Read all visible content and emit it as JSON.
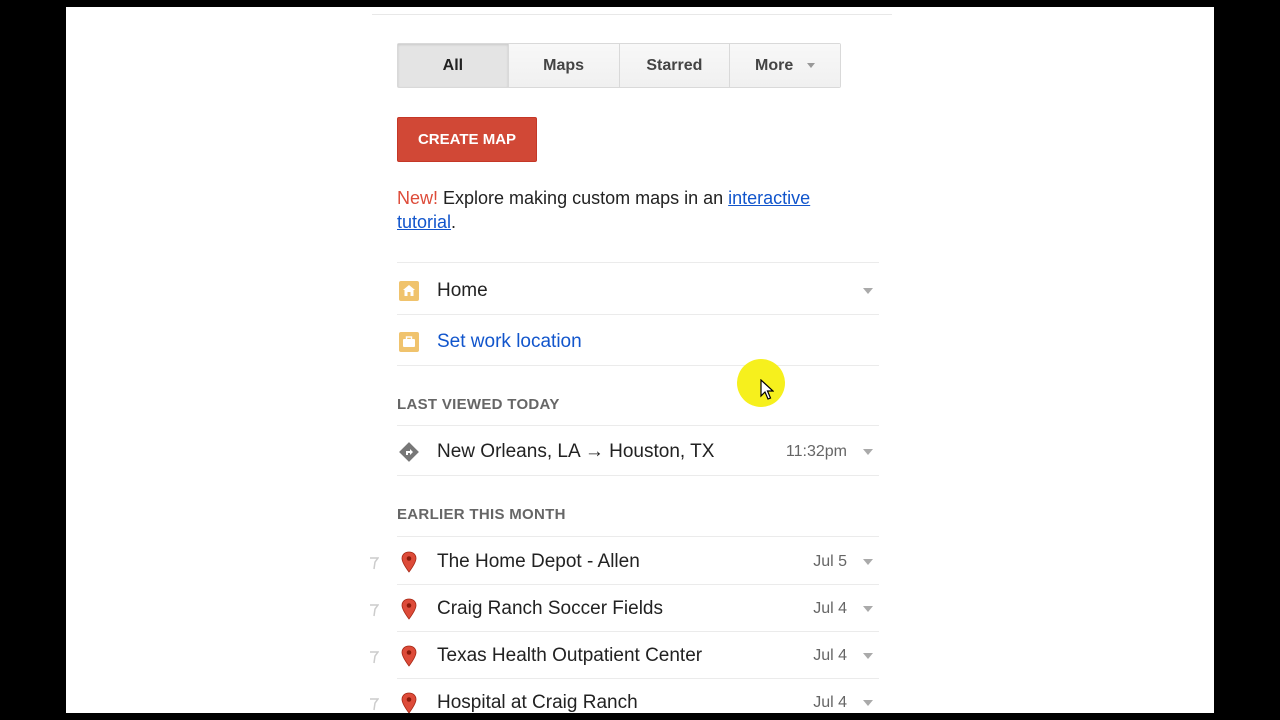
{
  "tabs": [
    {
      "label": "All",
      "active": true
    },
    {
      "label": "Maps",
      "active": false
    },
    {
      "label": "Starred",
      "active": false
    },
    {
      "label": "More",
      "active": false
    }
  ],
  "create_button": "CREATE MAP",
  "promo": {
    "new": "New!",
    "text": " Explore making custom maps in an ",
    "link_line1": "interactive",
    "link_line2": "tutorial",
    "period": "."
  },
  "places": {
    "home": {
      "label": "Home",
      "icon": "home-icon"
    },
    "work": {
      "label": "Set work location",
      "icon": "briefcase-icon"
    }
  },
  "sections": {
    "last_viewed": "LAST VIEWED TODAY",
    "earlier": "EARLIER THIS MONTH"
  },
  "recent": [
    {
      "label": "New Orleans, LA → Houston, TX",
      "time": "11:32pm",
      "icon": "directions-icon"
    }
  ],
  "earlier": [
    {
      "label": "The Home Depot - Allen",
      "time": "Jul 5",
      "icon": "map-pin-icon"
    },
    {
      "label": "Craig Ranch Soccer Fields",
      "time": "Jul 4",
      "icon": "map-pin-icon"
    },
    {
      "label": "Texas Health Outpatient Center",
      "time": "Jul 4",
      "icon": "map-pin-icon"
    },
    {
      "label": "Hospital at Craig Ranch",
      "time": "Jul 4",
      "icon": "map-pin-icon"
    }
  ],
  "colors": {
    "create_button": "#d14836",
    "link": "#1155cc",
    "new_badge": "#dd4b39",
    "cursor_highlight": "#f6f01d"
  }
}
